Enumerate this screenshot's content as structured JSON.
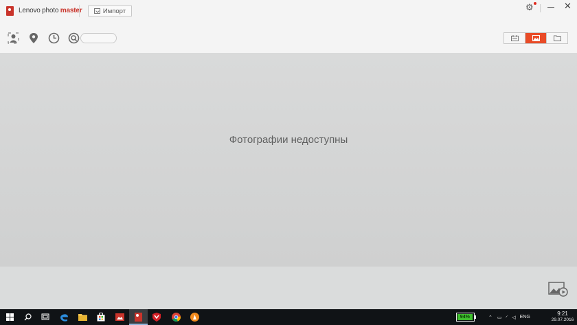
{
  "app": {
    "title_plain": "Lenovo photo ",
    "title_accent": "master",
    "import_label": "Импорт",
    "accent_color": "#e94b27"
  },
  "window_controls": {
    "settings_icon": "gear-icon",
    "minimize_icon": "minimize-icon",
    "close_icon": "close-icon"
  },
  "toolbar": {
    "filters": [
      "person-icon",
      "location-pin-icon",
      "clock-icon",
      "search-icon"
    ],
    "search_placeholder": "",
    "view_modes": [
      "calendar-view-icon",
      "photo-view-icon",
      "folder-view-icon"
    ],
    "active_view": "photo-view-icon"
  },
  "main": {
    "empty_message": "Фотографии недоступны"
  },
  "footer": {
    "slideshow_icon": "slideshow-icon"
  },
  "taskbar": {
    "apps": [
      "windows-start-icon",
      "search-icon",
      "task-view-icon",
      "edge-icon",
      "file-explorer-icon",
      "store-icon",
      "photo-app-icon",
      "lenovo-photo-master-icon",
      "mcafee-icon",
      "chrome-icon",
      "vlc-icon"
    ],
    "battery_percent": "94%",
    "language": "ENG",
    "time": "9:21",
    "date": "29.07.2016"
  }
}
